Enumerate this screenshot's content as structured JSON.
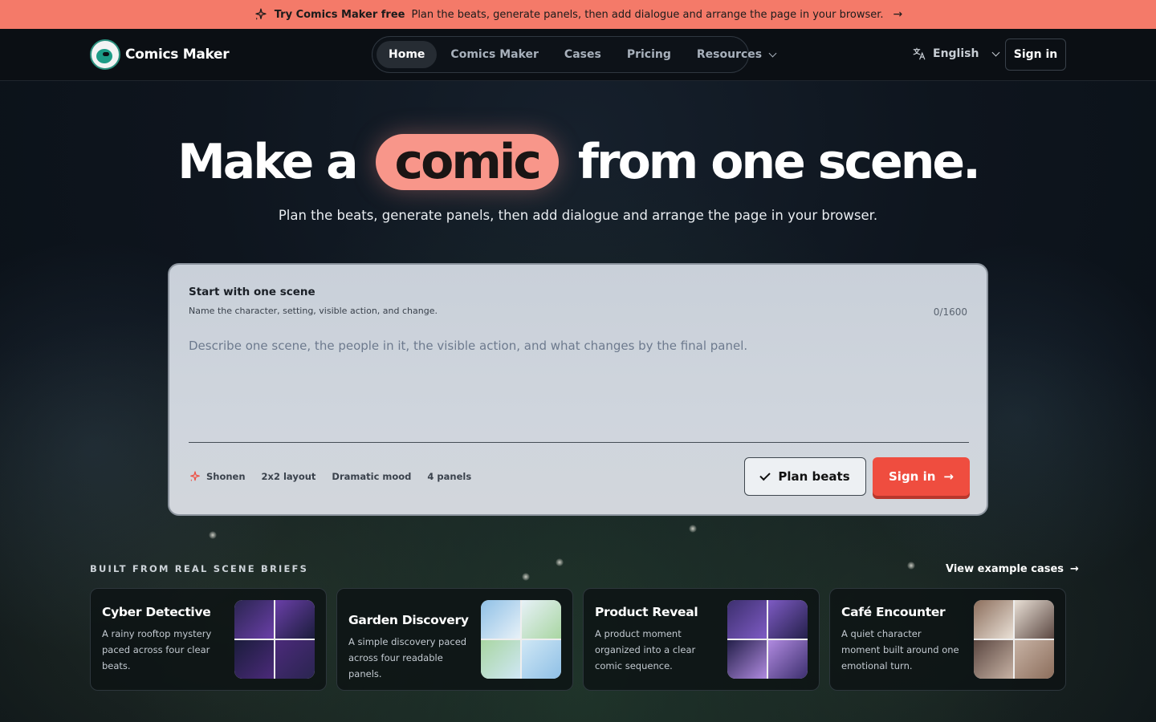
{
  "promo": {
    "bold": "Try Comics Maker free",
    "text": "Plan the beats, generate panels, then add dialogue and arrange the page in your browser.",
    "arrow": "→"
  },
  "header": {
    "brand": "Comics Maker",
    "nav": [
      {
        "label": "Home",
        "active": true
      },
      {
        "label": "Comics Maker"
      },
      {
        "label": "Cases"
      },
      {
        "label": "Pricing"
      },
      {
        "label": "Resources"
      }
    ],
    "language": "English",
    "signin": "Sign in"
  },
  "hero": {
    "title_before": "Make a",
    "title_highlight": "comic",
    "title_after": "from one scene.",
    "subtitle": "Plan the beats, generate panels, then add dialogue and arrange the page in your browser."
  },
  "prompt_card": {
    "title": "Start with one scene",
    "hint": "Name the character, setting, visible action, and change.",
    "counter": "0/1600",
    "placeholder": "Describe one scene, the people in it, the visible action, and what changes by the final panel.",
    "chips": [
      "Shonen",
      "2x2 layout",
      "Dramatic mood",
      "4 panels"
    ],
    "plan_button": "Plan beats",
    "signin_button": "Sign in",
    "arrow": "→"
  },
  "cases": {
    "label": "BUILT FROM REAL SCENE BRIEFS",
    "view_all": "View example cases",
    "arrow": "→",
    "items": [
      {
        "title": "Cyber Detective",
        "desc": "A rainy rooftop mystery paced across four clear beats.",
        "colors": [
          "#2a2550",
          "#6a3fa8",
          "#1b1d3c",
          "#4b2a7a"
        ]
      },
      {
        "title": "Garden Discovery",
        "desc": "A simple discovery paced across four readable panels.",
        "colors": [
          "#8fc0e6",
          "#e7f1f8",
          "#a9d6a2",
          "#cfe7f5"
        ]
      },
      {
        "title": "Product Reveal",
        "desc": "A product moment organized into a clear comic sequence.",
        "colors": [
          "#3c2f6e",
          "#7e5bc4",
          "#24204a",
          "#b08ae0"
        ]
      },
      {
        "title": "Café Encounter",
        "desc": "A quiet character moment built around one emotional turn.",
        "colors": [
          "#8c6e5c",
          "#e9e0d6",
          "#5b4741",
          "#c7b2a4"
        ]
      }
    ]
  },
  "colors": {
    "accent": "#f47a69",
    "cta": "#ef4d3f",
    "highlight_pill": "#f8968a"
  }
}
